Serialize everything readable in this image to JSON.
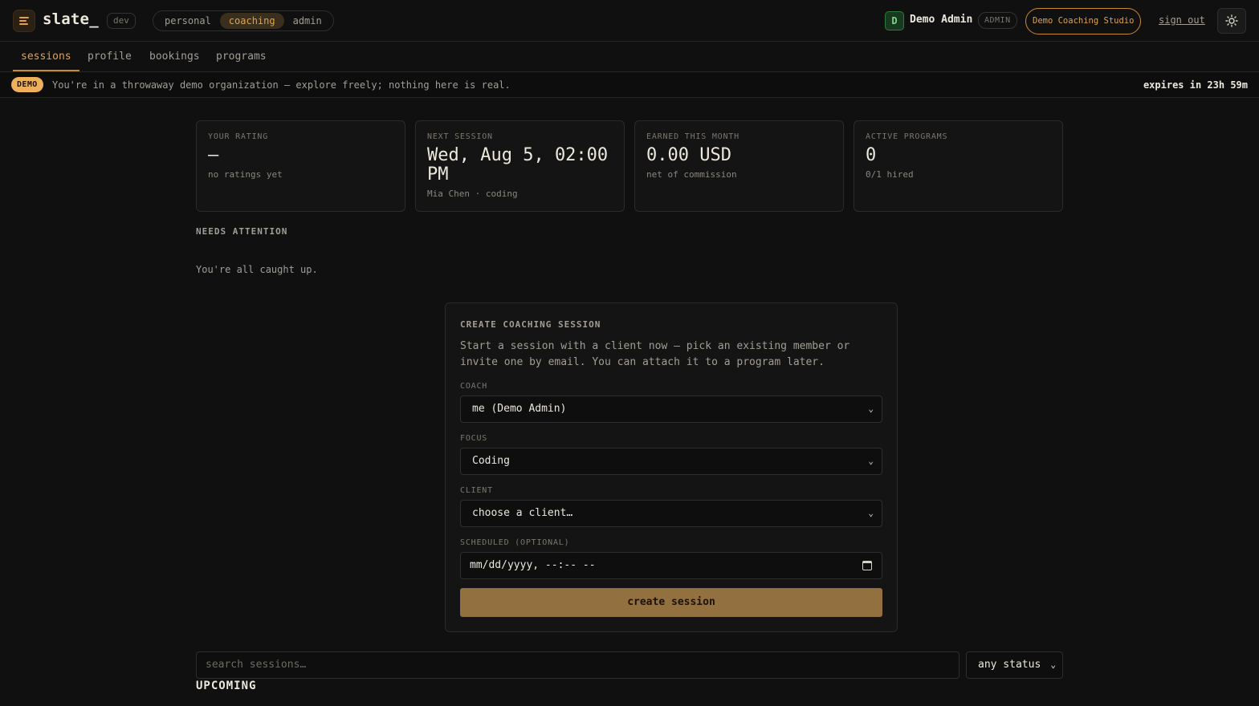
{
  "header": {
    "brand": "slate_",
    "env_badge": "dev",
    "contexts": [
      {
        "label": "personal",
        "active": false
      },
      {
        "label": "coaching",
        "active": true
      },
      {
        "label": "admin",
        "active": false
      }
    ],
    "user": {
      "initial": "D",
      "name": "Demo Admin",
      "role": "ADMIN",
      "org": "Demo Coaching Studio"
    },
    "sign_out": "sign out",
    "icons": {
      "menu": "menu-icon",
      "theme": "sun-icon"
    }
  },
  "subnav": {
    "items": [
      {
        "label": "sessions",
        "active": true
      },
      {
        "label": "profile",
        "active": false
      },
      {
        "label": "bookings",
        "active": false
      },
      {
        "label": "programs",
        "active": false
      }
    ]
  },
  "banner": {
    "badge": "DEMO",
    "text": "You're in a throwaway demo organization — explore freely; nothing here is real.",
    "expires": "expires in 23h 59m"
  },
  "stats": [
    {
      "label": "YOUR RATING",
      "value": "—",
      "sub": "no ratings yet"
    },
    {
      "label": "NEXT SESSION",
      "value": "Wed, Aug 5, 02:00 PM",
      "sub": "Mia Chen · coding"
    },
    {
      "label": "EARNED THIS MONTH",
      "value": "0.00 USD",
      "sub": "net of commission"
    },
    {
      "label": "ACTIVE PROGRAMS",
      "value": "0",
      "sub": "0/1 hired"
    }
  ],
  "attention": {
    "title": "NEEDS ATTENTION",
    "empty": "You're all caught up."
  },
  "create_form": {
    "title": "CREATE COACHING SESSION",
    "description": "Start a session with a client now — pick an existing member or invite one by email. You can attach it to a program later.",
    "coach_label": "COACH",
    "coach_value": "me (Demo Admin)",
    "focus_label": "FOCUS",
    "focus_value": "Coding",
    "client_label": "CLIENT",
    "client_value": "choose a client…",
    "scheduled_label": "SCHEDULED (OPTIONAL)",
    "scheduled_value": "mm/dd/yyyy, --:-- --",
    "submit": "create session"
  },
  "sessions": {
    "search_placeholder": "search sessions…",
    "status_filter": "any status",
    "upcoming_title": "UPCOMING"
  },
  "colors": {
    "accent": "#e2a24c",
    "button": "#93703f",
    "background": "#101010"
  }
}
